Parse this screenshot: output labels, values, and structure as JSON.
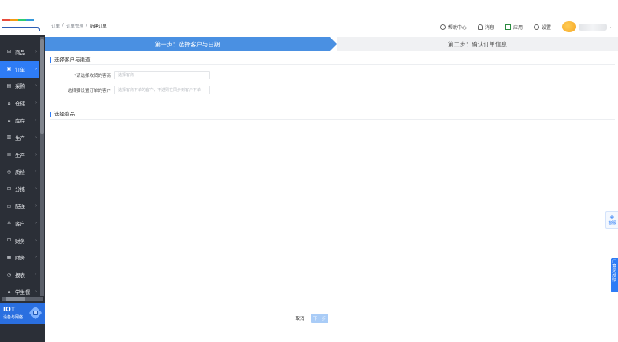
{
  "brand": {
    "logo_colors": [
      "#e74c3c",
      "#f39c12",
      "#2ecc71",
      "#3498db"
    ],
    "accent": "#2e7cf6"
  },
  "sidebar": {
    "items": [
      {
        "label": "商品",
        "icon": "grid-icon",
        "glyph": "⊞"
      },
      {
        "label": "订单",
        "icon": "order-icon",
        "glyph": "▣",
        "active": true
      },
      {
        "label": "采购",
        "icon": "purchase-icon",
        "glyph": "▤"
      },
      {
        "label": "仓储",
        "icon": "warehouse-icon",
        "glyph": "⌂"
      },
      {
        "label": "库存",
        "icon": "inventory-icon",
        "glyph": "⌂"
      },
      {
        "label": "生产",
        "icon": "production-icon",
        "glyph": "▥"
      },
      {
        "label": "生产",
        "icon": "production-icon",
        "glyph": "▥"
      },
      {
        "label": "质检",
        "icon": "inspection-icon",
        "glyph": "◎"
      },
      {
        "label": "分拣",
        "icon": "sorting-icon",
        "glyph": "⊟"
      },
      {
        "label": "配送",
        "icon": "delivery-icon",
        "glyph": "▭"
      },
      {
        "label": "客户",
        "icon": "customer-icon",
        "glyph": "♙"
      },
      {
        "label": "财务",
        "icon": "finance-icon",
        "glyph": "⊡"
      },
      {
        "label": "财务",
        "icon": "finance-icon",
        "glyph": "▦"
      },
      {
        "label": "报表",
        "icon": "report-icon",
        "glyph": "◷"
      },
      {
        "label": "学生餐",
        "icon": "meal-icon",
        "glyph": "⌂"
      }
    ],
    "iot": {
      "title": "IOT",
      "subtitle": "设备与网络"
    }
  },
  "header": {
    "breadcrumb": [
      "订单",
      "订单管理",
      "新建订单"
    ],
    "actions": {
      "help": "帮助中心",
      "notice": "消息",
      "apps": "应用",
      "settings": "设置"
    }
  },
  "steps": {
    "step1": "第一步：选择客户与日期",
    "step2": "第二步：确认订单信息"
  },
  "sections": {
    "customer": "选择客户与渠道",
    "products": "选择商品"
  },
  "form": {
    "field1": {
      "label": "*请选择收货的客商",
      "placeholder": "选择客商"
    },
    "field2": {
      "label": "选择要设置订单的客户",
      "placeholder": "选择客商下单的客户，不选则在同步到客户下单"
    }
  },
  "footer": {
    "cancel": "取消",
    "next": "下一步"
  },
  "floats": {
    "support": "客服",
    "feedback": "意见反馈"
  }
}
